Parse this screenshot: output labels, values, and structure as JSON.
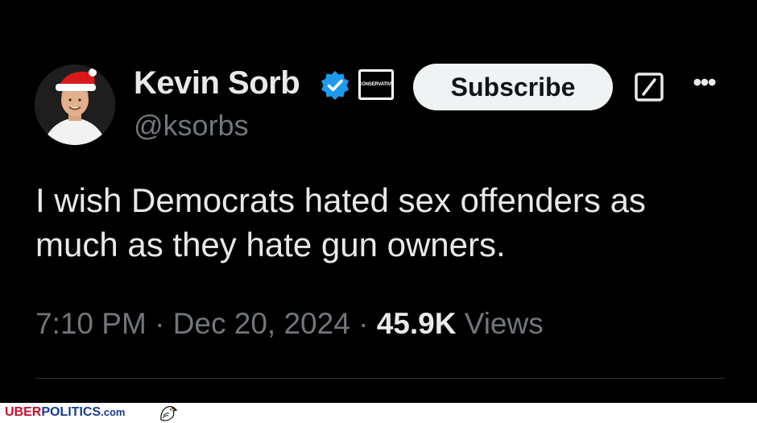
{
  "author": {
    "name": "Kevin Sorb",
    "handle": "@ksorbs",
    "affiliation_badge": "CONSERVATIVE",
    "verified": true,
    "avatar_icon": "avatar-santa-hat"
  },
  "actions": {
    "subscribe_label": "Subscribe",
    "grok_icon": "grok-icon",
    "more_icon": "more-options-icon",
    "more_glyph": "•••"
  },
  "tweet": {
    "text": "I wish Democrats hated sex offenders as much as they hate gun owners.",
    "time": "7:10 PM",
    "separator": "·",
    "date": "Dec 20, 2024",
    "views_count": "45.9K",
    "views_label": "Views"
  },
  "footer": {
    "brand_part1": "UBER",
    "brand_part2": "POLITICS",
    "brand_part3": ".com"
  },
  "colors": {
    "background": "#000000",
    "primary_text": "#e7e9ea",
    "secondary_text": "#71767b",
    "verified_blue": "#1d9bf0",
    "subscribe_bg": "#eff3f4"
  }
}
